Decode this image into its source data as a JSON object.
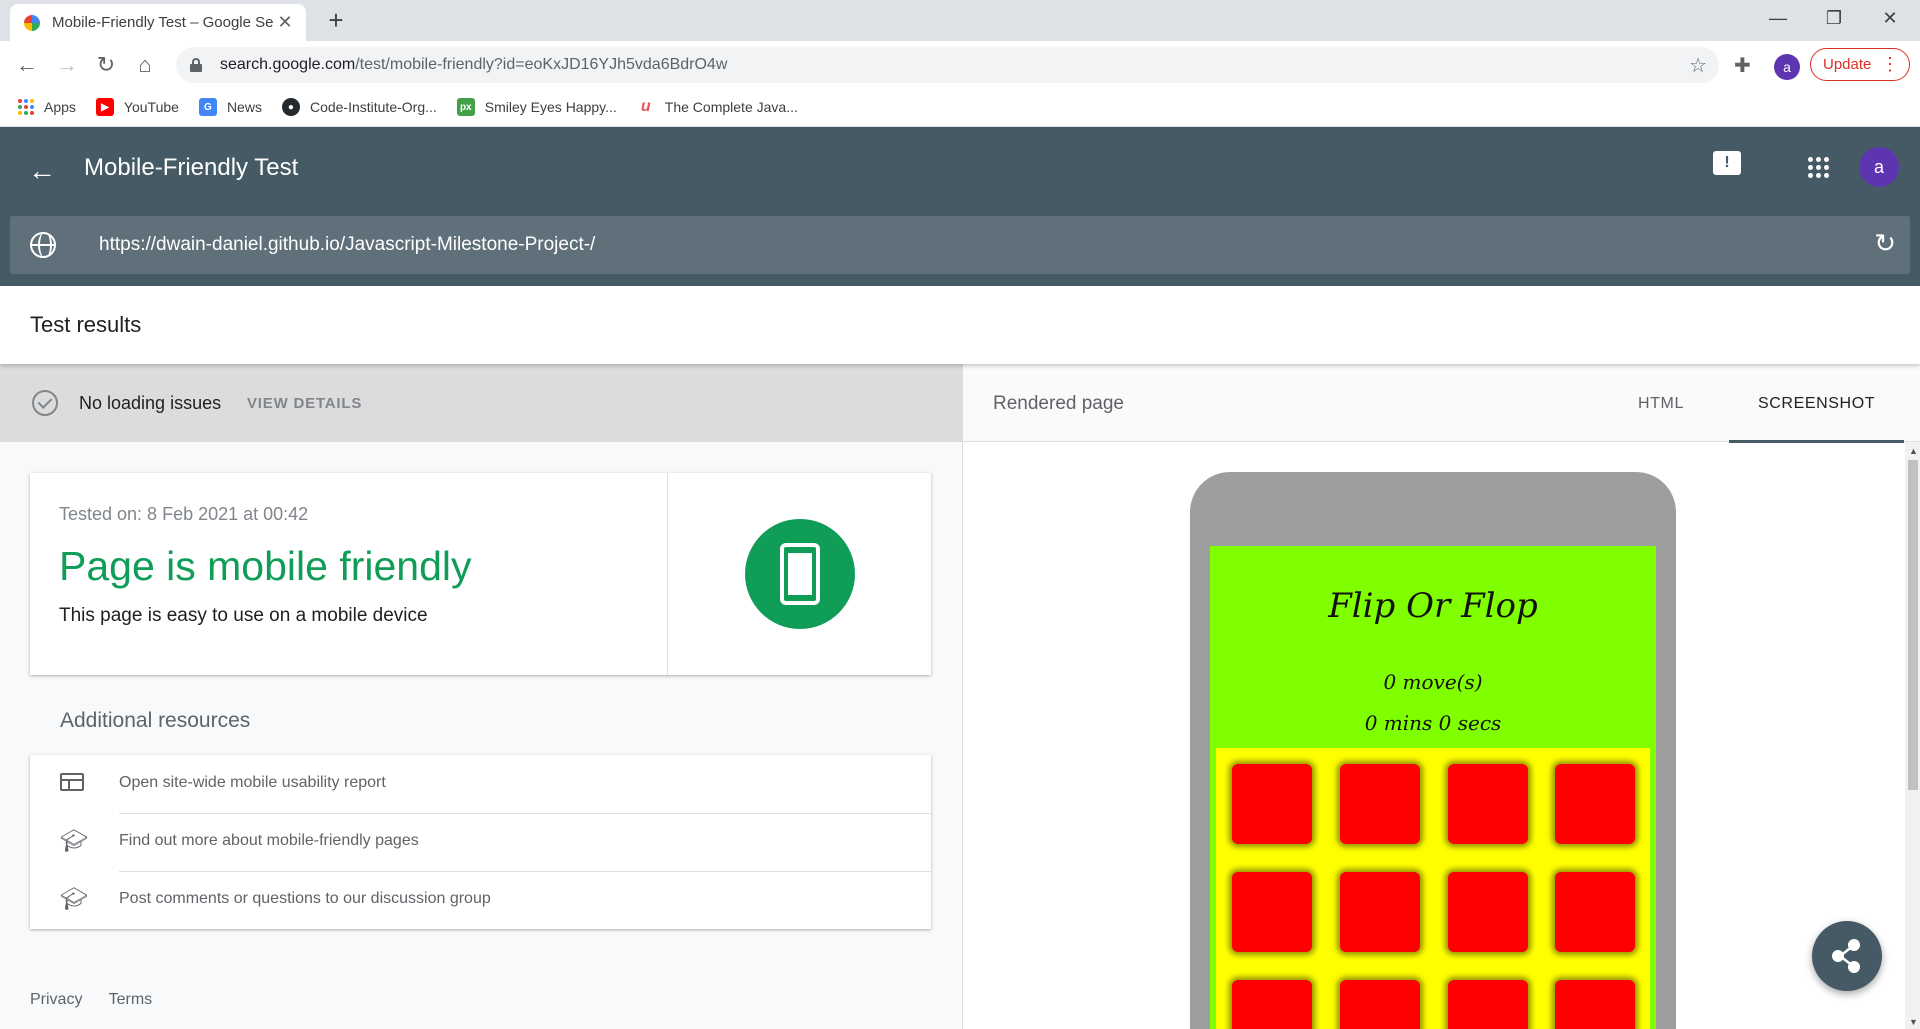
{
  "browser": {
    "tab_title": "Mobile-Friendly Test – Google Se",
    "tab_close": "✕",
    "new_tab": "+",
    "url_host": "search.google.com",
    "url_path": "/test/mobile-friendly?id=eoKxJD16YJh5vda6BdrO4w",
    "profile_letter": "a",
    "update_label": "Update",
    "bookmarks": [
      {
        "label": "Apps",
        "icon": "apps-grid-icon"
      },
      {
        "label": "YouTube",
        "icon": "youtube-icon",
        "color": "#ff0000"
      },
      {
        "label": "News",
        "icon": "google-news-icon",
        "color": "#4285f4"
      },
      {
        "label": "Code-Institute-Org...",
        "icon": "github-icon",
        "color": "#24292e"
      },
      {
        "label": "Smiley Eyes Happy...",
        "icon": "px-icon",
        "color": "#43a047"
      },
      {
        "label": "The Complete Java...",
        "icon": "udemy-icon",
        "color": "#ec5252"
      }
    ]
  },
  "app": {
    "title": "Mobile-Friendly Test",
    "avatar_letter": "a",
    "tested_url": "https://dwain-daniel.github.io/Javascript-Milestone-Project-/",
    "results_title": "Test results",
    "status": {
      "text": "No loading issues",
      "action": "VIEW DETAILS"
    },
    "result": {
      "tested_on": "Tested on: 8 Feb 2021 at 00:42",
      "verdict": "Page is mobile friendly",
      "verdict_sub": "This page is easy to use on a mobile device",
      "accent": "#0f9d58"
    },
    "resources": {
      "heading": "Additional resources",
      "items": [
        {
          "label": "Open site-wide mobile usability report",
          "icon": "web-report-icon"
        },
        {
          "label": "Find out more about mobile-friendly pages",
          "icon": "school-icon"
        },
        {
          "label": "Post comments or questions to our discussion group",
          "icon": "school-icon"
        }
      ]
    },
    "footer": {
      "privacy": "Privacy",
      "terms": "Terms"
    },
    "rendered": {
      "title": "Rendered page",
      "tabs": [
        {
          "label": "HTML",
          "active": false
        },
        {
          "label": "SCREENSHOT",
          "active": true
        }
      ]
    },
    "game": {
      "title": "Flip Or Flop",
      "moves": "0 move(s)",
      "time": "0 mins 0 secs"
    }
  }
}
